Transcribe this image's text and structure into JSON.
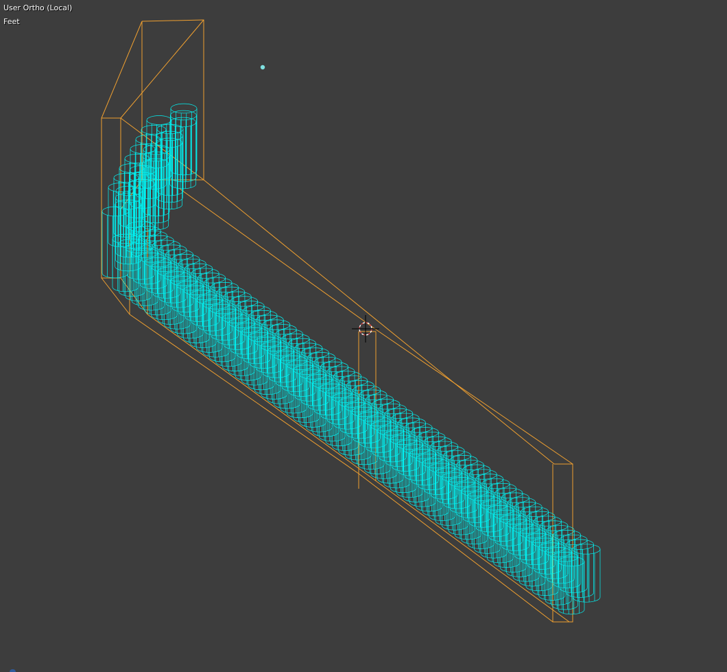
{
  "viewport": {
    "view_label": "User Ortho (Local)",
    "unit_label": "Feet"
  },
  "colors": {
    "background": "#3d3d3d",
    "mesh_wire": "#00f5f5",
    "bounding_box": "#f0a030",
    "lamp_point": "#7fe0e0",
    "cursor_ring": "#d04040",
    "cursor_cross": "#000000"
  },
  "icons": {
    "cursor": "3d-cursor-icon",
    "lamp": "lamp-point-icon",
    "corner": "navigation-widget-icon"
  }
}
